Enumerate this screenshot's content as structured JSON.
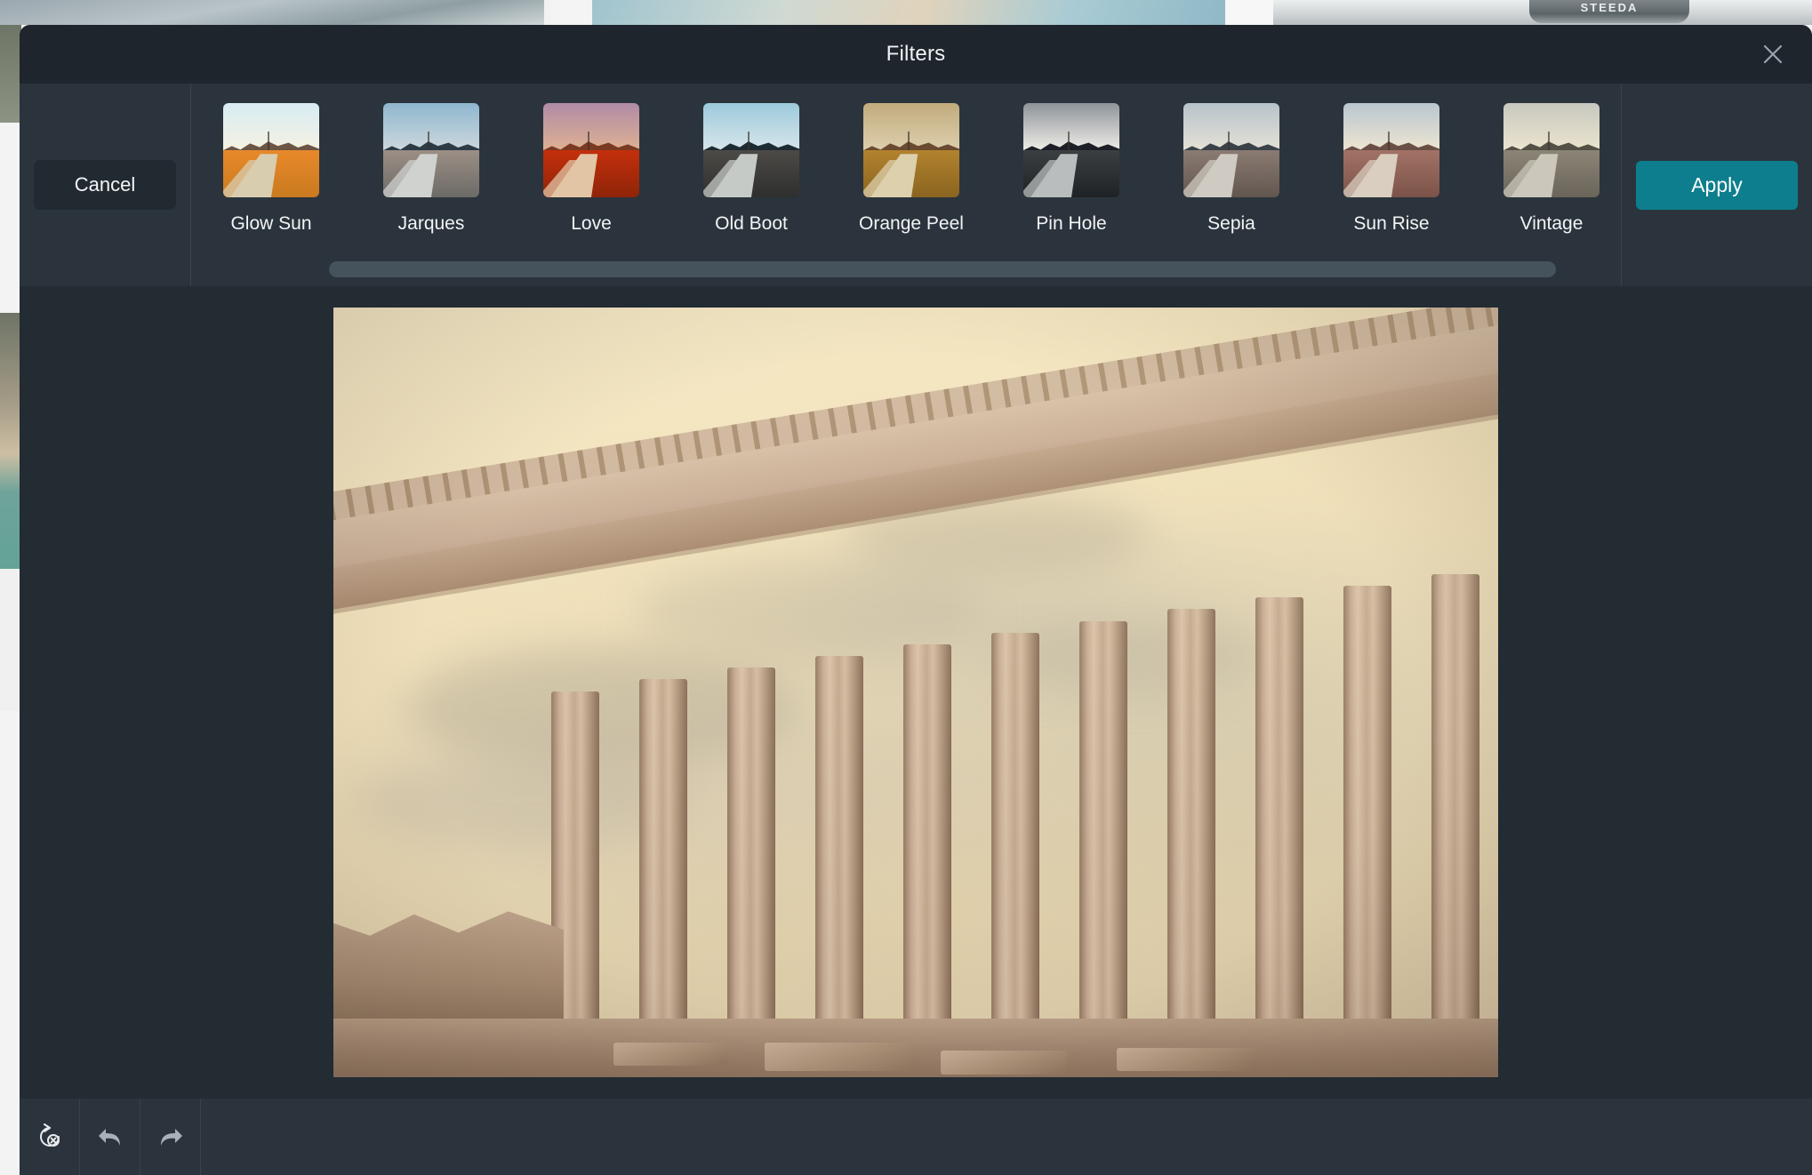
{
  "background": {
    "description": "photo gallery grid visible behind modal",
    "steeda_label": "STEEDA"
  },
  "modal": {
    "title": "Filters",
    "close_icon": "close-icon",
    "cancel_label": "Cancel",
    "apply_label": "Apply",
    "accent_color": "#0d7e8d",
    "panel_color": "#232b33",
    "header_color": "#1e252c",
    "strip_color": "#2b343c"
  },
  "filters": [
    {
      "label": "Glow Sun",
      "sky_top": "#d7ecf3",
      "sky_bottom": "#f6f2e2",
      "mtn": "#6b5544",
      "ground_top": "#e8892a",
      "ground_bottom": "#c97a20",
      "rail": "#d9cdb0"
    },
    {
      "label": "Jarques",
      "sky_top": "#8fb6cf",
      "sky_bottom": "#cfd9dd",
      "mtn": "#2c3b46",
      "ground_top": "#9b8f85",
      "ground_bottom": "#6c6a66",
      "rail": "#cfd2cf"
    },
    {
      "label": "Love",
      "sky_top": "#b08ba6",
      "sky_bottom": "#e0b292",
      "mtn": "#7a3a22",
      "ground_top": "#c42f0c",
      "ground_bottom": "#8f2408",
      "rail": "#e2c5a5"
    },
    {
      "label": "Old Boot",
      "sky_top": "#9dcadd",
      "sky_bottom": "#d9e6ea",
      "mtn": "#1f2b33",
      "ground_top": "#4d4a46",
      "ground_bottom": "#2e2f2e",
      "rail": "#c6cac6"
    },
    {
      "label": "Orange Peel",
      "sky_top": "#c1ab7d",
      "sky_bottom": "#ded0ae",
      "mtn": "#6a4a30",
      "ground_top": "#b2832e",
      "ground_bottom": "#8a6420",
      "rail": "#ddd0ad"
    },
    {
      "label": "Pin Hole",
      "sky_top": "#8e9499",
      "sky_bottom": "#f2f0ea",
      "mtn": "#1c2026",
      "ground_top": "#3c3f42",
      "ground_bottom": "#1f2225",
      "rail": "#b9bdbe"
    },
    {
      "label": "Sepia",
      "sky_top": "#b7c3cb",
      "sky_bottom": "#e6e2d6",
      "mtn": "#3a4249",
      "ground_top": "#8b7b72",
      "ground_bottom": "#61564f",
      "rail": "#cfcbc2"
    },
    {
      "label": "Sun Rise",
      "sky_top": "#b9c6cf",
      "sky_bottom": "#efe6d2",
      "mtn": "#6a4f45",
      "ground_top": "#a27266",
      "ground_bottom": "#7c5349",
      "rail": "#d9cec0"
    },
    {
      "label": "Vintage",
      "sky_top": "#c8c8bf",
      "sky_bottom": "#ece5cf",
      "mtn": "#545046",
      "ground_top": "#8c8577",
      "ground_bottom": "#6a6459",
      "rail": "#cbc7bb"
    }
  ],
  "scrollbar": {
    "orientation": "horizontal",
    "thumb_color": "#45535c"
  },
  "preview": {
    "subject": "Parthenon temple ruins under cloudy sky",
    "applied_tone": "warm sepia"
  },
  "toolbar": {
    "buttons": [
      {
        "name": "reset-button",
        "icon": "reset-icon"
      },
      {
        "name": "undo-button",
        "icon": "undo-arrow-icon"
      },
      {
        "name": "redo-button",
        "icon": "redo-arrow-icon"
      }
    ]
  }
}
